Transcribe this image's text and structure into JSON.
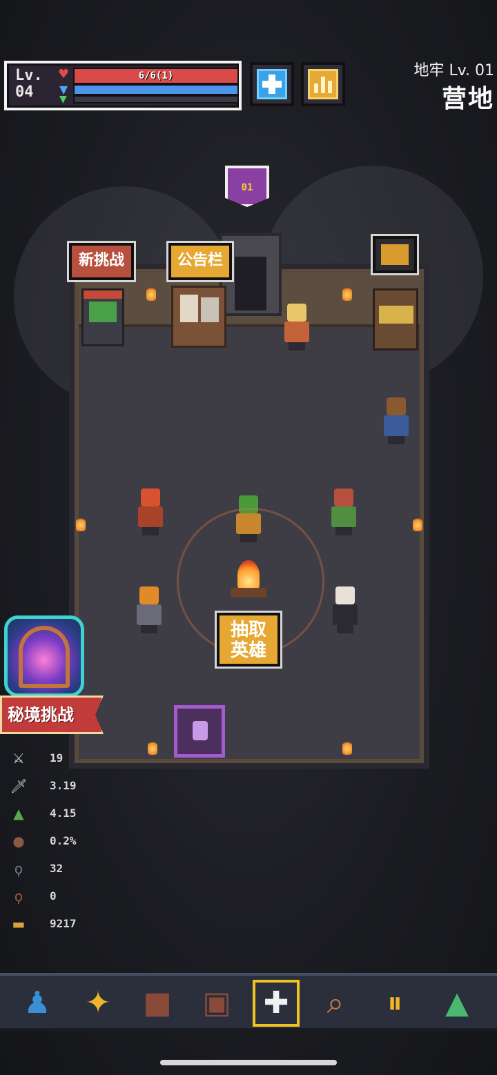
{
  "hud": {
    "level_label": "Lv.",
    "level_value": "04",
    "hp_text": "6/6(1)",
    "hp_fraction": 1.0,
    "mp_fraction": 1.0,
    "xp_fraction": 0.0,
    "heal_icon": "plus-icon",
    "stats_icon": "bar-chart-icon"
  },
  "location": {
    "dungeon_level": "地牢 Lv. 01",
    "area_name": "营地"
  },
  "map": {
    "floor_banner": "01",
    "signs": {
      "new_challenge": "新挑战",
      "bulletin_board": "公告栏"
    },
    "summon_button": "抽取英雄"
  },
  "portal": {
    "label": "秘境挑战"
  },
  "stats": [
    {
      "icon": "crossed-swords-icon",
      "value": "19",
      "color": "#c9c9c9"
    },
    {
      "icon": "sword-icon",
      "value": "3.19",
      "color": "#c9c9c9"
    },
    {
      "icon": "boot-icon",
      "value": "4.15",
      "color": "#5fa84a"
    },
    {
      "icon": "shield-icon",
      "value": "0.2%",
      "color": "#8a5a45"
    },
    {
      "icon": "potion-blue-icon",
      "value": "32",
      "color": "#6a7b8a"
    },
    {
      "icon": "potion-red-icon",
      "value": "0",
      "color": "#9a5a3a"
    },
    {
      "icon": "coin-icon",
      "value": "9217",
      "color": "#d9a53a"
    }
  ],
  "bottom_nav": [
    {
      "icon": "hero-icon",
      "color": "#3a8fd8"
    },
    {
      "icon": "skill-star-icon",
      "color": "#f0b42a"
    },
    {
      "icon": "book-icon",
      "color": "#8a4a3a"
    },
    {
      "icon": "bag-icon",
      "color": "#8a4a3a"
    },
    {
      "icon": "camp-icon",
      "color": "#f0f0f0",
      "selected": true
    },
    {
      "icon": "search-icon",
      "color": "#c77a3a"
    },
    {
      "icon": "pause-icon",
      "color": "#f0b42a"
    },
    {
      "icon": "tent-icon",
      "color": "#4ab870"
    }
  ]
}
